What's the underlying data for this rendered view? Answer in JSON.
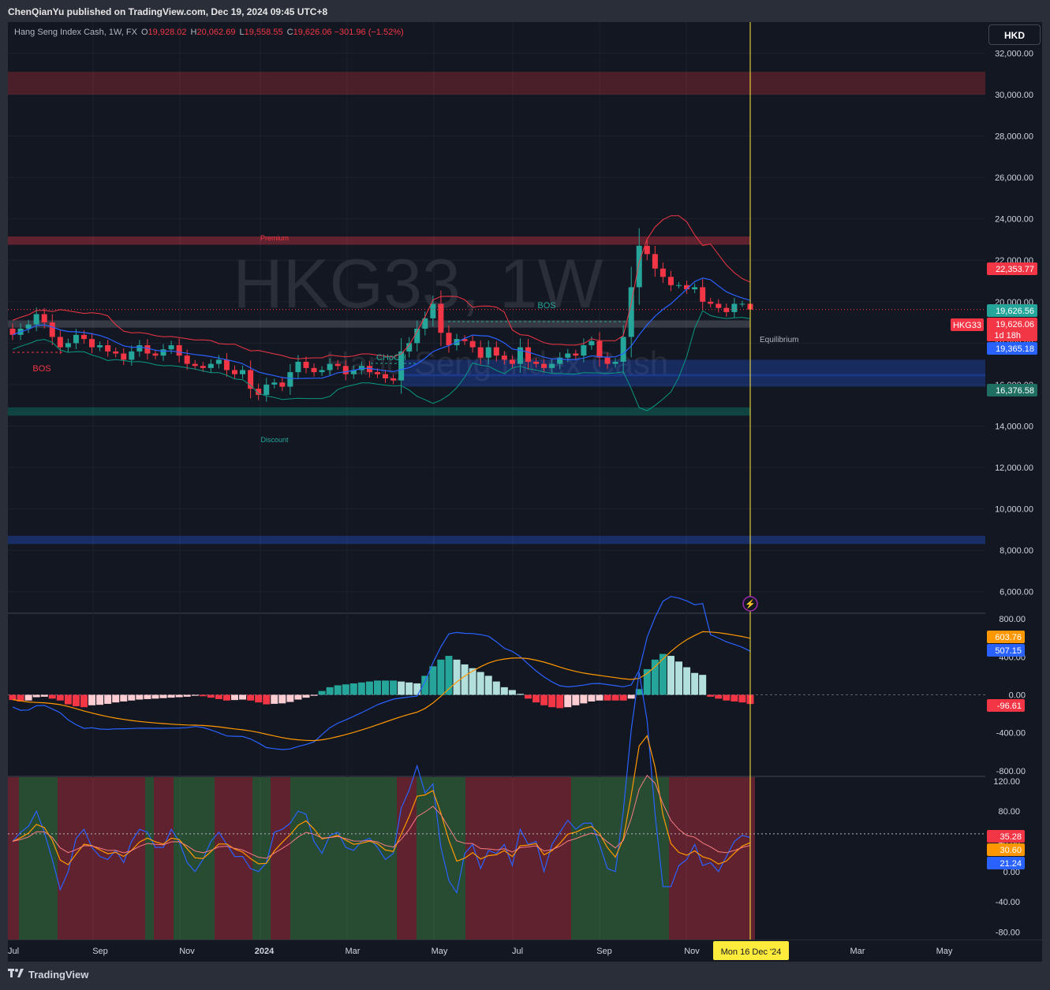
{
  "publisher_line": "ChenQianYu published on TradingView.com, Dec 19, 2024 09:45 UTC+8",
  "legend": {
    "name": "Hang Seng Index Cash, 1W, FX",
    "o_label": "O",
    "o": "19,928.02",
    "h_label": "H",
    "h": "20,062.69",
    "l_label": "L",
    "l": "19,558.55",
    "c_label": "C",
    "c": "19,626.06",
    "change": "−301.96 (−1.52%)"
  },
  "currency_button": "HKD",
  "watermark": {
    "symbol": "HKG33, 1W",
    "name": "Hang Seng Index Cash"
  },
  "footer_brand": "TradingView",
  "colors": {
    "bg": "#131722",
    "up": "#26a69a",
    "down": "#f23645",
    "ma_blue": "#2962ff",
    "band_red": "#f23645",
    "band_green": "#089981",
    "orange": "#ff9800",
    "cursor": "#ffeb3b"
  },
  "chart_data": [
    {
      "type": "candlestick",
      "title": "Hang Seng Index Cash, 1W, FX",
      "ylim": [
        5000,
        33500
      ],
      "y_ticks": [
        "32,000.00",
        "30,000.00",
        "28,000.00",
        "26,000.00",
        "24,000.00",
        "22,000.00",
        "20,000.00",
        "18,000.00",
        "16,000.00",
        "14,000.00",
        "12,000.00",
        "10,000.00",
        "8,000.00",
        "6,000.00"
      ],
      "x_ticks": [
        "Jul",
        "Sep",
        "Nov",
        "2024",
        "Mar",
        "May",
        "Jul",
        "Sep",
        "Nov",
        "Mar",
        "May"
      ],
      "candles_close": [
        18400,
        18700,
        18900,
        19400,
        19000,
        18300,
        17800,
        18000,
        18400,
        18200,
        17800,
        17900,
        17600,
        17500,
        17200,
        17600,
        17900,
        17500,
        17400,
        17700,
        17900,
        17400,
        17000,
        16900,
        16800,
        17000,
        17200,
        16700,
        16500,
        16700,
        15800,
        15500,
        16000,
        16100,
        15900,
        16600,
        17100,
        16800,
        16600,
        16700,
        17000,
        16900,
        16500,
        16700,
        16900,
        16600,
        16500,
        16300,
        16200,
        17600,
        18000,
        18700,
        19200,
        19900,
        18500,
        17900,
        18200,
        18100,
        17800,
        17300,
        17800,
        17400,
        17200,
        17000,
        17800,
        17100,
        17000,
        16800,
        17000,
        17300,
        17500,
        17400,
        17900,
        18100,
        17300,
        17000,
        17100,
        18300,
        20700,
        22700,
        22300,
        21600,
        21200,
        20800,
        20800,
        20600,
        20700,
        20000,
        19900,
        19700,
        19500,
        19900,
        19900,
        19626
      ],
      "labels": [
        "Premium",
        "BOS",
        "BOS",
        "CHoCH",
        "Equilibrium",
        "Discount"
      ],
      "price_labels": {
        "upper_band": "22,353.77",
        "last_close": "19,626.56",
        "last_price": "19,626.06",
        "countdown": "1d 18h",
        "ma": "19,365.18",
        "lower_band": "16,376.58",
        "symbol": "HKG33"
      },
      "zones": [
        {
          "name": "supply",
          "from": 30000,
          "to": 31100
        },
        {
          "name": "premium",
          "from": 22750,
          "to": 23150
        },
        {
          "name": "equilibrium",
          "from": 18750,
          "to": 19100
        },
        {
          "name": "demand-1",
          "from": 16400,
          "to": 17200
        },
        {
          "name": "demand-2",
          "from": 15900,
          "to": 16500
        },
        {
          "name": "discount",
          "from": 14500,
          "to": 14900
        },
        {
          "name": "deep-demand",
          "from": 8300,
          "to": 8700
        }
      ]
    },
    {
      "type": "bar",
      "title": "MACD",
      "ylim": [
        -850,
        850
      ],
      "y_ticks": [
        "800.00",
        "400.00",
        "0.00",
        "-400.00",
        "-800.00"
      ],
      "histogram": [
        -55,
        -70,
        -60,
        -25,
        -20,
        -40,
        -60,
        -100,
        -120,
        -130,
        -110,
        -105,
        -95,
        -80,
        -70,
        -60,
        -50,
        -45,
        -40,
        -35,
        -30,
        -25,
        -20,
        -10,
        -15,
        -30,
        -45,
        -60,
        -55,
        -50,
        -60,
        -80,
        -100,
        -95,
        -90,
        -75,
        -50,
        -30,
        -10,
        40,
        80,
        100,
        110,
        120,
        130,
        140,
        150,
        150,
        150,
        140,
        130,
        120,
        200,
        300,
        370,
        410,
        370,
        320,
        280,
        240,
        200,
        140,
        80,
        50,
        10,
        -40,
        -80,
        -110,
        -130,
        -140,
        -130,
        -110,
        -90,
        -70,
        -60,
        -60,
        -60,
        -60,
        -40,
        60,
        270,
        370,
        430,
        410,
        350,
        290,
        230,
        210,
        -20,
        -40,
        -60,
        -70,
        -80,
        -96.61
      ],
      "price_labels": {
        "signal": "603.76",
        "macd": "507.15",
        "hist": "-96.61"
      }
    },
    {
      "type": "line",
      "title": "RSI",
      "ylim": [
        -90,
        125
      ],
      "y_ticks": [
        "120.00",
        "80.00",
        "40.00",
        "0.00",
        "-40.00",
        "-80.00"
      ],
      "price_labels": {
        "line1": "35.28",
        "line2": "30.60",
        "line3": "21.24"
      }
    }
  ],
  "cursor_label": "Mon 16 Dec '24"
}
